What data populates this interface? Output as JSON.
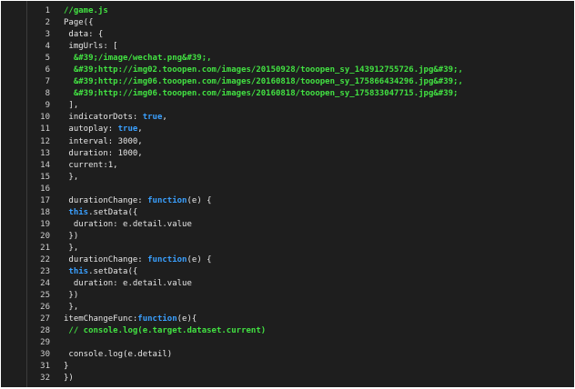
{
  "editor": {
    "language": "javascript",
    "colors": {
      "background": "#1e1e1e",
      "gutter_border": "#3c3c3c",
      "line_number": "#cfcfcf",
      "plain": "#e6e6e6",
      "comment": "#42e142",
      "string": "#42e142",
      "keyword": "#3aa0ff"
    },
    "lines": [
      {
        "num": "1",
        "tokens": [
          {
            "t": "//game.js",
            "k": "comment"
          }
        ]
      },
      {
        "num": "2",
        "tokens": [
          {
            "t": "Page({",
            "k": "plain"
          }
        ]
      },
      {
        "num": "3",
        "tokens": [
          {
            "t": " data: {",
            "k": "plain"
          }
        ]
      },
      {
        "num": "4",
        "tokens": [
          {
            "t": " imgUrls: [",
            "k": "plain"
          }
        ]
      },
      {
        "num": "5",
        "tokens": [
          {
            "t": "  &#39;/image/wechat.png&#39;,",
            "k": "string"
          }
        ]
      },
      {
        "num": "6",
        "tokens": [
          {
            "t": "  &#39;http://img02.tooopen.com/images/20150928/tooopen_sy_143912755726.jpg&#39;,",
            "k": "string"
          }
        ]
      },
      {
        "num": "7",
        "tokens": [
          {
            "t": "  &#39;http://img06.tooopen.com/images/20160818/tooopen_sy_175866434296.jpg&#39;,",
            "k": "string"
          }
        ]
      },
      {
        "num": "8",
        "tokens": [
          {
            "t": "  &#39;http://img06.tooopen.com/images/20160818/tooopen_sy_175833047715.jpg&#39;",
            "k": "string"
          }
        ]
      },
      {
        "num": "9",
        "tokens": [
          {
            "t": " ],",
            "k": "plain"
          }
        ]
      },
      {
        "num": "10",
        "tokens": [
          {
            "t": " indicatorDots: ",
            "k": "plain"
          },
          {
            "t": "true",
            "k": "keyword"
          },
          {
            "t": ",",
            "k": "plain"
          }
        ]
      },
      {
        "num": "11",
        "tokens": [
          {
            "t": " autoplay: ",
            "k": "plain"
          },
          {
            "t": "true",
            "k": "keyword"
          },
          {
            "t": ",",
            "k": "plain"
          }
        ]
      },
      {
        "num": "12",
        "tokens": [
          {
            "t": " interval: 3000,",
            "k": "plain"
          }
        ]
      },
      {
        "num": "13",
        "tokens": [
          {
            "t": " duration: 1000,",
            "k": "plain"
          }
        ]
      },
      {
        "num": "14",
        "tokens": [
          {
            "t": " current:1,",
            "k": "plain"
          }
        ]
      },
      {
        "num": "15",
        "tokens": [
          {
            "t": " },",
            "k": "plain"
          }
        ]
      },
      {
        "num": "16",
        "tokens": [
          {
            "t": "",
            "k": "plain"
          }
        ]
      },
      {
        "num": "17",
        "tokens": [
          {
            "t": " durationChange: ",
            "k": "plain"
          },
          {
            "t": "function",
            "k": "keyword"
          },
          {
            "t": "(e) {",
            "k": "plain"
          }
        ]
      },
      {
        "num": "18",
        "tokens": [
          {
            "t": " ",
            "k": "plain"
          },
          {
            "t": "this",
            "k": "keyword"
          },
          {
            "t": ".setData({",
            "k": "plain"
          }
        ]
      },
      {
        "num": "19",
        "tokens": [
          {
            "t": "  duration: e.detail.value",
            "k": "plain"
          }
        ]
      },
      {
        "num": "20",
        "tokens": [
          {
            "t": " })",
            "k": "plain"
          }
        ]
      },
      {
        "num": "21",
        "tokens": [
          {
            "t": " },",
            "k": "plain"
          }
        ]
      },
      {
        "num": "22",
        "tokens": [
          {
            "t": " durationChange: ",
            "k": "plain"
          },
          {
            "t": "function",
            "k": "keyword"
          },
          {
            "t": "(e) {",
            "k": "plain"
          }
        ]
      },
      {
        "num": "23",
        "tokens": [
          {
            "t": " ",
            "k": "plain"
          },
          {
            "t": "this",
            "k": "keyword"
          },
          {
            "t": ".setData({",
            "k": "plain"
          }
        ]
      },
      {
        "num": "24",
        "tokens": [
          {
            "t": "  duration: e.detail.value",
            "k": "plain"
          }
        ]
      },
      {
        "num": "25",
        "tokens": [
          {
            "t": " })",
            "k": "plain"
          }
        ]
      },
      {
        "num": "26",
        "tokens": [
          {
            "t": " },",
            "k": "plain"
          }
        ]
      },
      {
        "num": "27",
        "tokens": [
          {
            "t": "itemChangeFunc:",
            "k": "plain"
          },
          {
            "t": "function",
            "k": "keyword"
          },
          {
            "t": "(e){",
            "k": "plain"
          }
        ]
      },
      {
        "num": "28",
        "tokens": [
          {
            "t": " // console.log(e.target.dataset.current)",
            "k": "comment"
          }
        ]
      },
      {
        "num": "29",
        "tokens": [
          {
            "t": "",
            "k": "plain"
          }
        ]
      },
      {
        "num": "30",
        "tokens": [
          {
            "t": " console.log(e.detail)",
            "k": "plain"
          }
        ]
      },
      {
        "num": "31",
        "tokens": [
          {
            "t": "}",
            "k": "plain"
          }
        ]
      },
      {
        "num": "32",
        "tokens": [
          {
            "t": "})",
            "k": "plain"
          }
        ]
      }
    ]
  }
}
